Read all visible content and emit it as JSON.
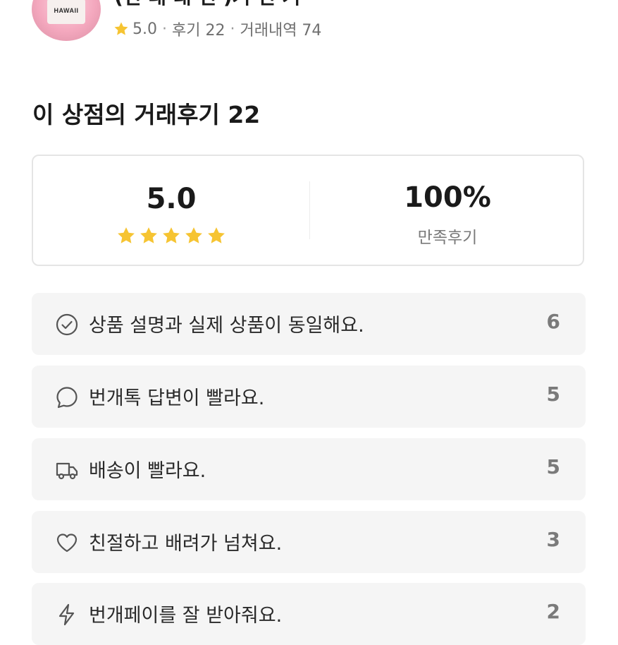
{
  "shop": {
    "avatar_text": "HAWAII",
    "name": "(건 대 래 건 )거 건 거",
    "rating": "5.0",
    "reviews": "후기 22",
    "trades": "거래내역 74"
  },
  "section_title": "이 상점의 거래후기 22",
  "summary": {
    "score": "5.0",
    "stars": 5,
    "satisfaction": "100%",
    "satisfaction_label": "만족후기"
  },
  "review_items": [
    {
      "icon": "check-circle-icon",
      "label": "상품 설명과 실제 상품이 동일해요.",
      "count": "6"
    },
    {
      "icon": "chat-bubble-icon",
      "label": "번개톡 답변이 빨라요.",
      "count": "5"
    },
    {
      "icon": "truck-icon",
      "label": "배송이 빨라요.",
      "count": "5"
    },
    {
      "icon": "heart-icon",
      "label": "친절하고 배려가 넘쳐요.",
      "count": "3"
    },
    {
      "icon": "lightning-icon",
      "label": "번개페이를 잘 받아줘요.",
      "count": "2"
    }
  ],
  "colors": {
    "star": "#f6c432",
    "card_bg": "#f5f5f5",
    "border": "#e5e5e5"
  }
}
